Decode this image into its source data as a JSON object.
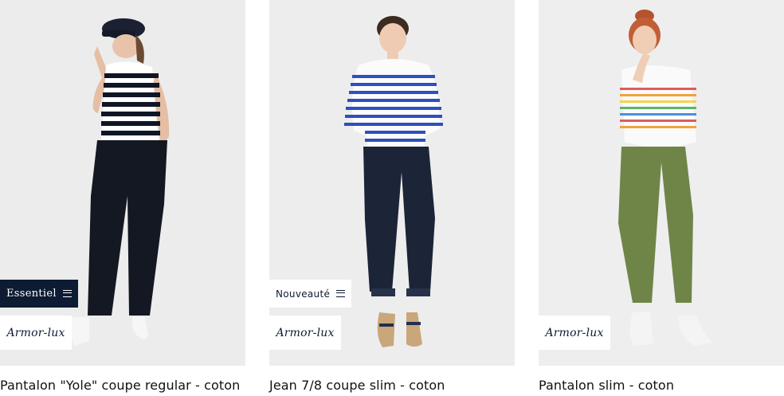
{
  "colors": {
    "badge_dark": "#0d1b33",
    "photo_bg": "#ebebeb"
  },
  "products": [
    {
      "title": "Pantalon \"Yole\" coupe regular - coton",
      "badge": "Essentiel",
      "badge_style": "dark",
      "brand": "Armor-lux"
    },
    {
      "title": "Jean 7/8 coupe slim - coton",
      "badge": "Nouveauté",
      "badge_style": "light",
      "brand": "Armor-lux"
    },
    {
      "title": "Pantalon slim - coton",
      "badge": "",
      "badge_style": "",
      "brand": "Armor-lux"
    }
  ]
}
